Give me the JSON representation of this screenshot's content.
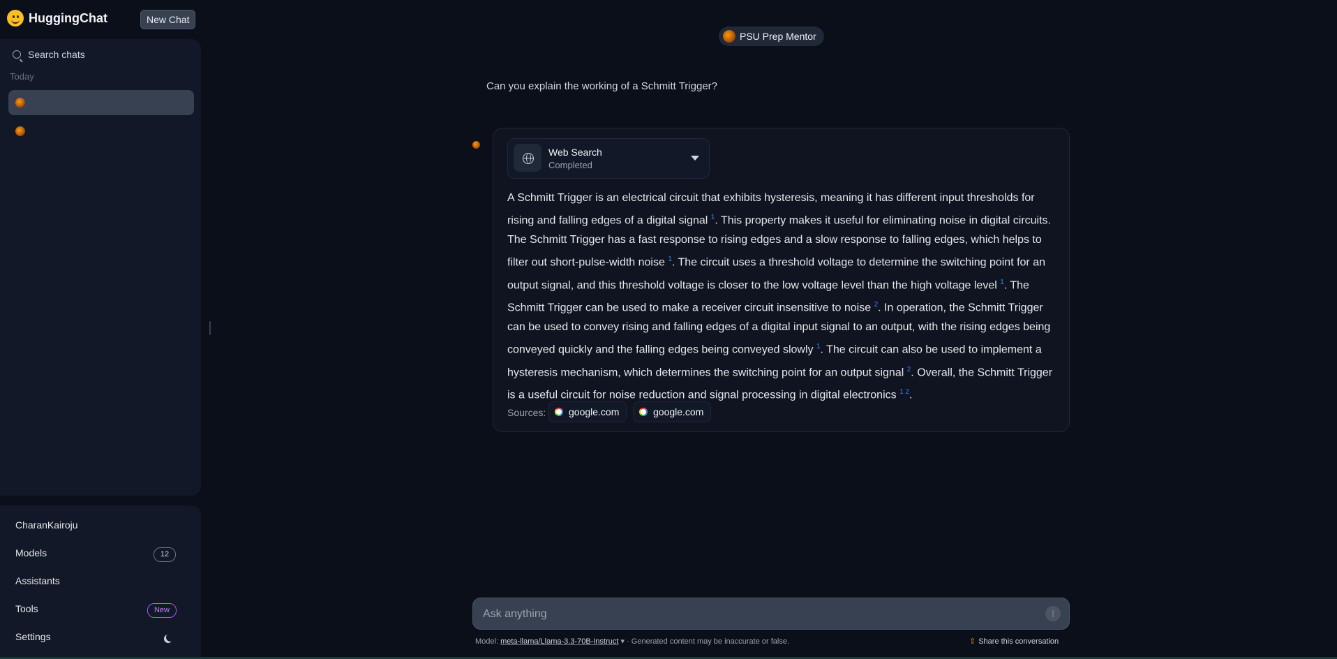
{
  "app": {
    "brand": "HuggingChat",
    "new_chat": "New Chat"
  },
  "sidebar": {
    "search_label": "Search chats",
    "section_today": "Today",
    "chats": [
      {
        "label": ""
      },
      {
        "label": ""
      }
    ],
    "user": "CharanKairoju",
    "models_label": "Models",
    "models_count": "12",
    "assistants_label": "Assistants",
    "tools_label": "Tools",
    "tools_badge": "New",
    "settings_label": "Settings"
  },
  "conversation": {
    "assistant_name": "PSU Prep Mentor",
    "user_message": "Can you explain the working of a Schmitt Trigger?",
    "web_search": {
      "title": "Web Search",
      "status": "Completed"
    },
    "answer_parts": [
      {
        "t": "A Schmitt Trigger is an electrical circuit that exhibits hysteresis, meaning it has different input thresholds for rising and falling edges of a digital signal "
      },
      {
        "sup": "1"
      },
      {
        "t": ". This property makes it useful for eliminating noise in digital circuits. The Schmitt Trigger has a fast response to rising edges and a slow response to falling edges, which helps to filter out short-pulse-width noise "
      },
      {
        "sup": "1"
      },
      {
        "t": ". The circuit uses a threshold voltage to determine the switching point for an output signal, and this threshold voltage is closer to the low voltage level than the high voltage level "
      },
      {
        "sup": "1"
      },
      {
        "t": ". The Schmitt Trigger can be used to make a receiver circuit insensitive to noise "
      },
      {
        "sup": "2"
      },
      {
        "t": ". In operation, the Schmitt Trigger can be used to convey rising and falling edges of a digital input signal to an output, with the rising edges being conveyed quickly and the falling edges being conveyed slowly "
      },
      {
        "sup": "1"
      },
      {
        "t": ". The circuit can also be used to implement a hysteresis mechanism, which determines the switching point for an output signal "
      },
      {
        "sup": "2"
      },
      {
        "t": ". Overall, the Schmitt Trigger is a useful circuit for noise reduction and signal processing in digital electronics "
      },
      {
        "sup": "1 2"
      },
      {
        "t": "."
      }
    ],
    "sources_label": "Sources:",
    "sources": [
      "google.com",
      "google.com"
    ]
  },
  "composer": {
    "placeholder": "Ask anything",
    "model_prefix": "Model:",
    "model_name": "meta-llama/Llama-3.3-70B-Instruct",
    "disclaimer": " · Generated content may be inaccurate or false.",
    "share": "Share this conversation"
  },
  "colors": {
    "background": "#0b0f19",
    "panel": "#111827",
    "accent_link": "#3b82f6",
    "badge_new": "#a855f7"
  }
}
